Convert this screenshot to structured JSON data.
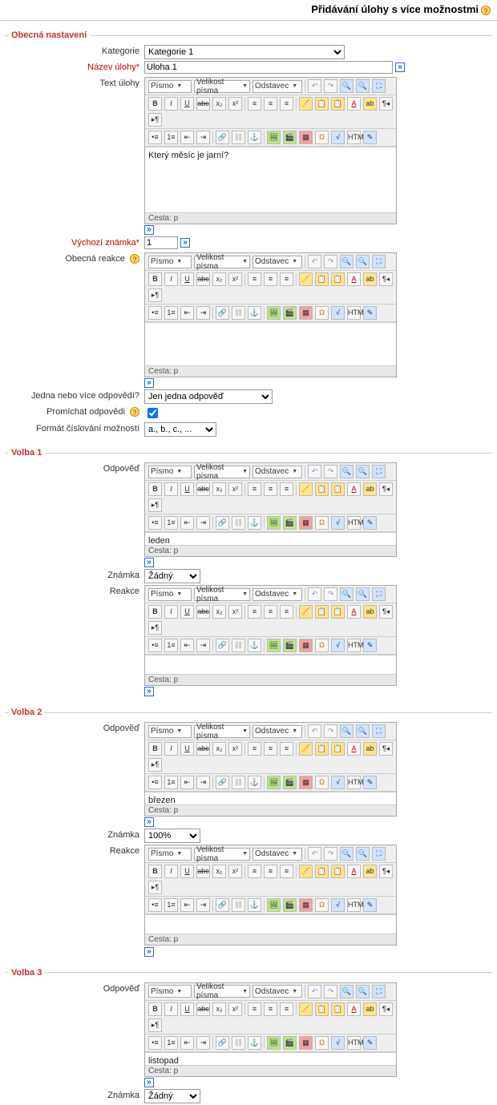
{
  "page": {
    "title": "Přidávání úlohy s více možnostmi"
  },
  "general": {
    "legend": "Obecná nastavení",
    "category_label": "Kategorie",
    "category_value": "Kategorie 1",
    "name_label": "Název úlohy*",
    "name_value": "Úloha 1",
    "text_label": "Text úlohy",
    "text_content": "Který měsíc je jarní?",
    "path_label": "Cesta: p",
    "default_grade_label": "Výchozí známka*",
    "default_grade_value": "1",
    "general_feedback_label": "Obecná reakce",
    "general_feedback_content": "",
    "one_or_many_label": "Jedna nebo více odpovědí?",
    "one_or_many_value": "Jen jedna odpověď",
    "shuffle_label": "Promíchat odpovědi",
    "shuffle_checked": true,
    "numbering_label": "Formát číslování možností",
    "numbering_value": "a., b., c., ..."
  },
  "editor_ui": {
    "font_label": "Písmo",
    "size_label": "Velikost písma",
    "format_label": "Odstavec"
  },
  "choices": [
    {
      "legend": "Volba 1",
      "answer_label": "Odpověď",
      "answer": "leden",
      "grade_label": "Známka",
      "grade": "Žádný",
      "feedback_label": "Reakce",
      "feedback": ""
    },
    {
      "legend": "Volba 2",
      "answer_label": "Odpověď",
      "answer": "březen",
      "grade_label": "Známka",
      "grade": "100%",
      "feedback_label": "Reakce",
      "feedback": ""
    },
    {
      "legend": "Volba 3",
      "answer_label": "Odpověď",
      "answer": "listopad",
      "grade_label": "Známka",
      "grade": "Žádný",
      "feedback_label": "Reakce",
      "feedback": ""
    }
  ]
}
